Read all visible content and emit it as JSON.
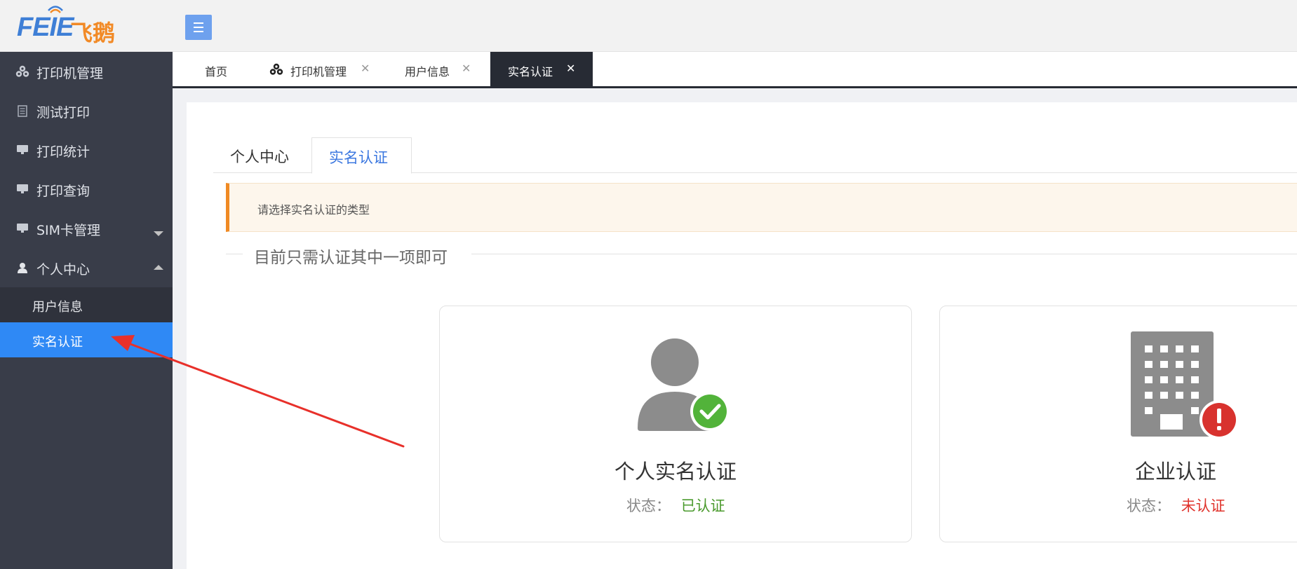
{
  "header": {
    "logo_latin": "FEIE",
    "logo_cjk": "飞鹅",
    "menu_toggle_icon": "hamburger-icon"
  },
  "sidebar": {
    "items": [
      {
        "label": "打印机管理",
        "icon": "printers-icon"
      },
      {
        "label": "测试打印",
        "icon": "document-icon"
      },
      {
        "label": "打印统计",
        "icon": "monitor-icon"
      },
      {
        "label": "打印查询",
        "icon": "monitor-icon"
      },
      {
        "label": "SIM卡管理",
        "icon": "monitor-icon"
      },
      {
        "label": "个人中心",
        "icon": "user-icon"
      }
    ],
    "sub_items": [
      {
        "label": "用户信息"
      },
      {
        "label": "实名认证"
      }
    ],
    "active_color": "#2f89f5"
  },
  "tabs": [
    {
      "label": "首页"
    },
    {
      "label": "打印机管理",
      "icon": "printers-icon"
    },
    {
      "label": "用户信息"
    },
    {
      "label": "实名认证"
    }
  ],
  "page_tabs": [
    {
      "label": "个人中心"
    },
    {
      "label": "实名认证"
    }
  ],
  "notice": {
    "text": "请选择实名认证的类型",
    "accent": "#f08a24"
  },
  "legend": "目前只需认证其中一项即可",
  "cards": [
    {
      "title": "个人实名认证",
      "status_label": "状态：",
      "status_value": "已认证",
      "status_color": "#4a9a2d",
      "icon": "user-verified-icon"
    },
    {
      "title": "企业认证",
      "status_label": "状态：",
      "status_value": "未认证",
      "status_color": "#e0332c",
      "icon": "building-unverified-icon"
    }
  ],
  "annotation": {
    "type": "arrow",
    "color": "#e8302a"
  }
}
